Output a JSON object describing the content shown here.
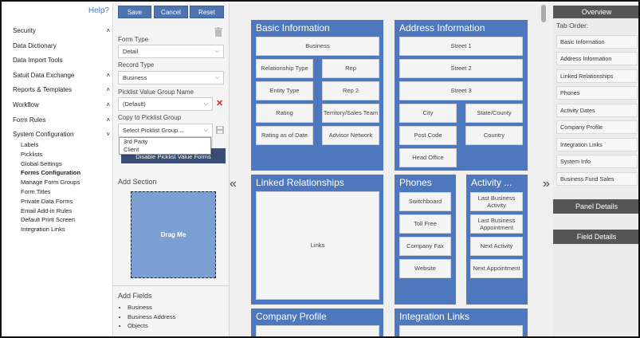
{
  "nav": {
    "help": "Help?",
    "items": [
      {
        "label": "Security",
        "caret": "^"
      },
      {
        "label": "Data Dictionary",
        "caret": ""
      },
      {
        "label": "Data Import Tools",
        "caret": ""
      },
      {
        "label": "Satuit Data Exchange",
        "caret": "^"
      },
      {
        "label": "Reports & Templates",
        "caret": "^"
      },
      {
        "label": "Workflow",
        "caret": "^"
      },
      {
        "label": "Form Rules",
        "caret": "^"
      },
      {
        "label": "System Configuration",
        "caret": "v"
      }
    ],
    "subitems": [
      "Labels",
      "Picklists",
      "Global Settings",
      "Forms Configuration",
      "Manage Form Groups",
      "Form Titles",
      "Private Data Forms",
      "Email Add-in Rules",
      "Default Print Screen",
      "Integration Links"
    ],
    "active_subitem": "Forms Configuration"
  },
  "toolbar": {
    "save": "Save",
    "cancel": "Cancel",
    "reset": "Reset"
  },
  "form": {
    "form_type_label": "Form Type",
    "form_type_value": "Detail",
    "record_type_label": "Record Type",
    "record_type_value": "Business",
    "picklist_group_label": "Picklist Value Group Name",
    "picklist_group_value": "(Default)",
    "copy_label": "Copy to Picklist Group",
    "copy_placeholder": "Select Picklist Group...",
    "dropdown_options": [
      "3rd Party",
      "Client"
    ],
    "disable_button": "Disable Picklist Value Forms",
    "add_section": "Add Section",
    "drag_me": "Drag Me",
    "add_fields": "Add Fields",
    "fields": [
      "Business",
      "Business Address",
      "Objects"
    ]
  },
  "canvas": {
    "basic": {
      "title": "Basic Information",
      "fields": [
        "Business",
        "Relationship Type",
        "Rep",
        "Entity Type",
        "Rep 2",
        "Rating",
        "Territory/Sales Team",
        "Rating as of Date",
        "Advisor Network"
      ]
    },
    "address": {
      "title": "Address Information",
      "fields": [
        "Street 1",
        "Street 2",
        "Street 3",
        "City",
        "State/County",
        "Post Code",
        "Country",
        "Head Office"
      ]
    },
    "linked": {
      "title": "Linked Relationships",
      "fields": [
        "Links"
      ]
    },
    "phones": {
      "title": "Phones",
      "fields": [
        "Switchboard",
        "Toll Free",
        "Company Fax",
        "Website"
      ]
    },
    "activity": {
      "title": "Activity ...",
      "fields": [
        "Last Business Activity",
        "Last Business Appointment",
        "Next Activity",
        "Next Appointment"
      ]
    },
    "company": {
      "title": "Company Profile"
    },
    "integration": {
      "title": "Integration Links"
    }
  },
  "right": {
    "overview": "Overview",
    "tab_order_label": "Tab Order:",
    "tabs": [
      "Basic Information",
      "Address Information",
      "Linked Relationships",
      "Phones",
      "Activity Dates",
      "Company Profile",
      "Integration Links",
      "System Info",
      "Business Fund Sales"
    ],
    "panel_details": "Panel Details",
    "field_details": "Field Details"
  },
  "colors": {
    "accent": "#4e78bd",
    "button": "#4e73b1",
    "header": "#555555"
  }
}
